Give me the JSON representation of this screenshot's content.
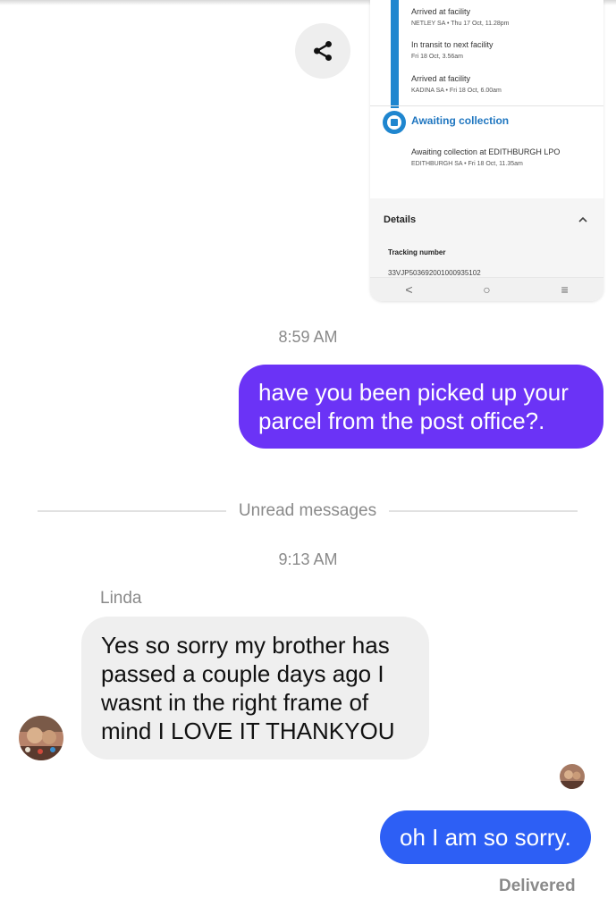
{
  "shared_image": {
    "events": [
      {
        "title": "Arrived at facility",
        "detail": "NETLEY SA • Thu 17 Oct, 11.28pm"
      },
      {
        "title": "In transit to next facility",
        "detail": "Fri 18 Oct, 3.56am"
      },
      {
        "title": "Arrived at facility",
        "detail": "KADINA SA • Fri 18 Oct, 6.00am"
      }
    ],
    "awaiting_title": "Awaiting collection",
    "awaiting_detail_1": "Awaiting collection at EDITHBURGH LPO",
    "awaiting_detail_2": "EDITHBURGH SA • Fri 18 Oct, 11.35am",
    "details_title": "Details",
    "tracking_label": "Tracking number",
    "tracking_number": "33VJP503692001000935102",
    "nav_back": "<",
    "nav_home": "○",
    "nav_recents": "≡",
    "accent_color": "#1f86cf"
  },
  "share_button": {
    "icon": "share-icon"
  },
  "timestamp_1": "8:59 AM",
  "message_out_1": "have you been picked up your parcel from the post office?.",
  "unread_divider": "Unread messages",
  "timestamp_2": "9:13 AM",
  "sender_name": "Linda",
  "message_in_1": "Yes so sorry my brother has passed a couple days ago I wasnt in the right frame of mind I LOVE IT THANKYOU",
  "message_out_2": "oh I am so sorry.",
  "status": "Delivered",
  "colors": {
    "outgoing_purple": "#6b33f6",
    "outgoing_blue": "#2d5ff5",
    "incoming_gray": "#efefef"
  }
}
